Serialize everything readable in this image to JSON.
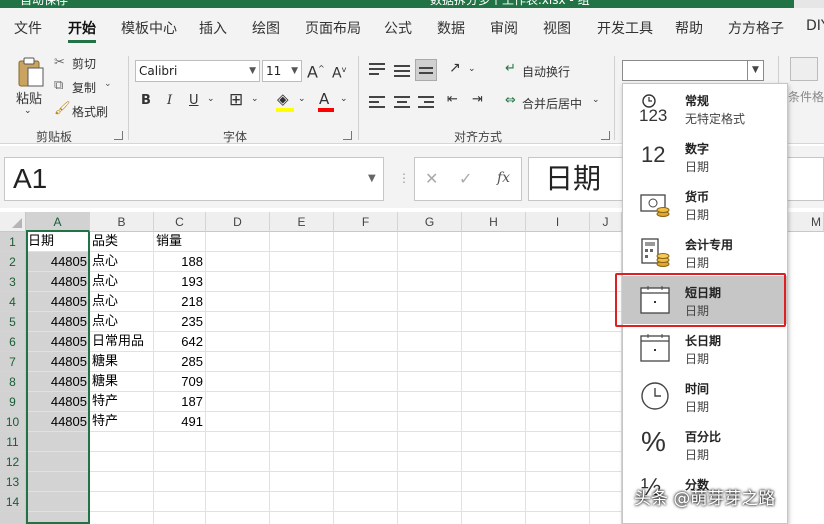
{
  "title_bar": {
    "left_text": "自动保存",
    "file_name": "数据拆分多个工作表.xlsx - 组"
  },
  "tabs": [
    "文件",
    "开始",
    "模板中心",
    "插入",
    "绘图",
    "页面布局",
    "公式",
    "数据",
    "审阅",
    "视图",
    "开发工具",
    "帮助",
    "方方格子",
    "DIY"
  ],
  "active_tab": "开始",
  "accent_color": "#217346",
  "highlight_color": "#e02020",
  "ribbon": {
    "clipboard": {
      "paste": "粘贴",
      "cut": "剪切",
      "copy": "复制",
      "format_painter": "格式刷",
      "label": "剪贴板"
    },
    "font": {
      "name": "Calibri",
      "size": "11",
      "grow": "A",
      "shrink": "A",
      "bold": "B",
      "italic": "I",
      "underline": "U",
      "font_color": "A",
      "label": "字体"
    },
    "alignment": {
      "wrap": "自动换行",
      "merge": "合并后居中",
      "label": "对齐方式"
    },
    "conditional": "条件格式"
  },
  "name_box": "A1",
  "fx_label": "fx",
  "formula": "日期",
  "columns": [
    "A",
    "B",
    "C",
    "D",
    "E",
    "F",
    "G",
    "H",
    "I",
    "J",
    "M"
  ],
  "rows": [
    "1",
    "2",
    "3",
    "4",
    "5",
    "6",
    "7",
    "8",
    "9",
    "10",
    "11",
    "12",
    "13",
    "14"
  ],
  "table": {
    "headers": [
      "日期",
      "品类",
      "销量"
    ],
    "rows": [
      [
        "44805",
        "点心",
        "188"
      ],
      [
        "44805",
        "点心",
        "193"
      ],
      [
        "44805",
        "点心",
        "218"
      ],
      [
        "44805",
        "点心",
        "235"
      ],
      [
        "44805",
        "日常用品",
        "642"
      ],
      [
        "44805",
        "糖果",
        "285"
      ],
      [
        "44805",
        "糖果",
        "709"
      ],
      [
        "44805",
        "特产",
        "187"
      ],
      [
        "44805",
        "特产",
        "491"
      ]
    ]
  },
  "number_format_menu": [
    {
      "name": "常规",
      "sample": "无特定格式",
      "icon": "general-123-icon",
      "glyph": "123"
    },
    {
      "name": "数字",
      "sample": "日期",
      "icon": "number-12-icon",
      "glyph": "12"
    },
    {
      "name": "货币",
      "sample": "日期",
      "icon": "currency-icon"
    },
    {
      "name": "会计专用",
      "sample": "日期",
      "icon": "accounting-icon"
    },
    {
      "name": "短日期",
      "sample": "日期",
      "icon": "calendar-icon",
      "highlighted": true
    },
    {
      "name": "长日期",
      "sample": "日期",
      "icon": "calendar-icon"
    },
    {
      "name": "时间",
      "sample": "日期",
      "icon": "clock-icon"
    },
    {
      "name": "百分比",
      "sample": "日期",
      "icon": "percent-icon",
      "glyph": "%"
    },
    {
      "name": "分数",
      "sample": "",
      "icon": "fraction-icon",
      "glyph": "½"
    }
  ],
  "watermark": "头条 @萌芽芽之路"
}
